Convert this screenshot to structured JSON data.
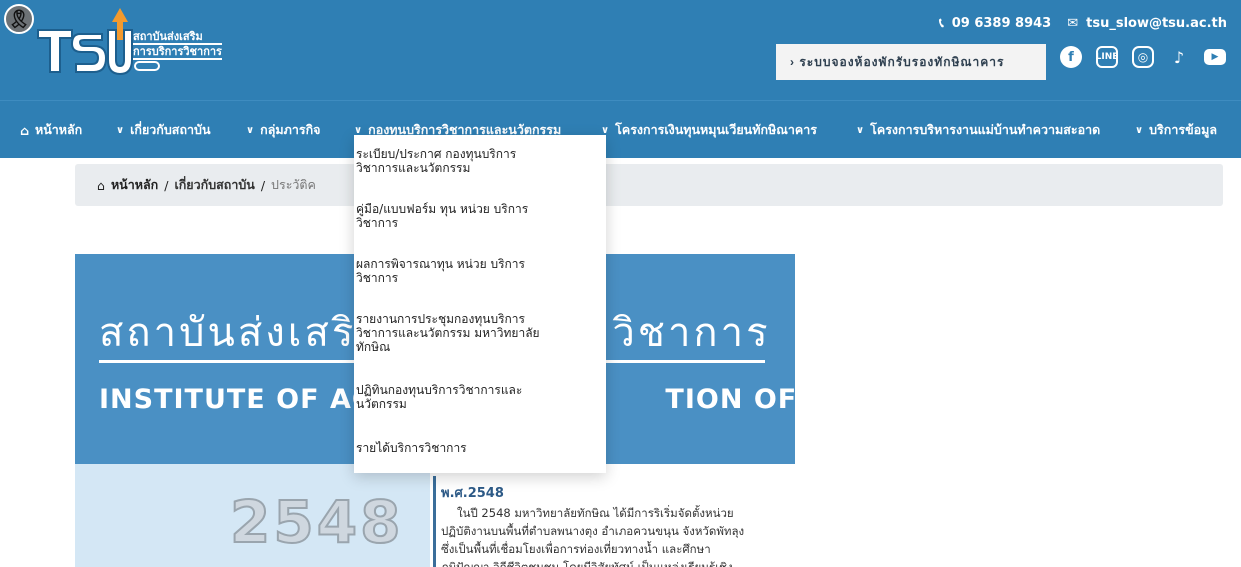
{
  "logo": {
    "line1": "สถาบันส่งเสริม",
    "line2": "การบริการวิชาการ",
    "mark": "TSU",
    "ribbon": "🎗"
  },
  "contact": {
    "phone": "09 6389 8943",
    "email": "tsu_slow@tsu.ac.th",
    "phone_icon": "phone-icon",
    "email_icon": "mail-icon"
  },
  "booking_label": "› ระบบจองห้องพักรับรองทักษิณาคาร",
  "socials": [
    "facebook-icon",
    "line-icon",
    "instagram-icon",
    "tiktok-icon",
    "youtube-icon"
  ],
  "nav": {
    "home": "หน้าหลัก",
    "items": [
      "เกี่ยวกับสถาบัน",
      "กลุ่มภารกิจ",
      "กองทุนบริการวิชาการและนวัตกรรม",
      "โครงการเงินทุนหมุนเวียนทักษิณาคาร",
      "โครงการบริหารงานแม่บ้านทำความสะอาด",
      "บริการข้อมูล"
    ]
  },
  "breadcrumb": {
    "home": "หน้าหลัก",
    "sep": "/",
    "level1": "เกี่ยวกับสถาบัน",
    "current": "ประวัติค"
  },
  "banner": {
    "thai_left": "สถาบันส่งเสริ",
    "thai_right": "วิชาการ",
    "en_left": "INSTITUTE OF ACADE",
    "en_right": "TION OFFICE"
  },
  "timeline": {
    "year": "2548",
    "title": "พ.ศ.2548",
    "lines": [
      "ในปี 2548 มหาวิทยาลัยทักษิณ ได้มีการริเริ่มจัดตั้งหน่วย",
      "ปฏิบัติงานบนพื้นที่ตำบลพนางตุง อำเภอควนขนุน จังหวัดพัทลุง",
      "ซึ่งเป็นพื้นที่เชื่อมโยงเพื่อการท่องเที่ยวทางน้ำ และศึกษา",
      "ภูมิปัญญา วิถีชีวิตชุมชน โดยมีวิสัยทัศน์ เป็นแหล่งเรียนรู้เชิง"
    ]
  },
  "dropdown": {
    "items": [
      [
        "ระเบียบ/ประกาศ กองทุนบริการ",
        "วิชาการและนวัตกรรม"
      ],
      [
        "คู่มือ/แบบฟอร์ม ทุน หน่วย บริการ",
        "วิชาการ"
      ],
      [
        "ผลการพิจารณาทุน หน่วย บริการ",
        "วิชาการ"
      ],
      [
        "รายงานการประชุมกองทุนบริการ",
        "วิชาการและนวัตกรรม มหาวิทยาลัย",
        "ทักษิณ"
      ],
      [
        "ปฏิทินกองทุนบริการวิชาการและ",
        "นวัตกรรม"
      ],
      [
        "รายได้บริการวิชาการ"
      ]
    ]
  },
  "colors": {
    "header": "#2f7fb4",
    "banner": "#4a90c4",
    "year_box": "#d4e7f5",
    "breadcrumb": "#e9ecef"
  }
}
